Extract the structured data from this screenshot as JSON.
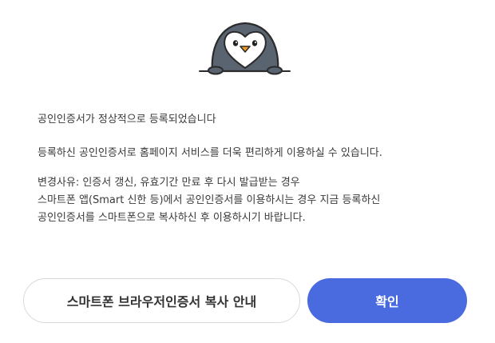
{
  "dialog": {
    "mascot_icon": "penguin-mascot-icon",
    "message_registered": "공인인증서가 정상적으로 등록되었습니다",
    "message_convenience": "등록하신 공인인증서로 홈페이지 서비스를 더욱 편리하게 이용하실 수 있습니다.",
    "reason_lines": [
      "변경사유: 인증서 갱신, 유효기간 만료 후 다시 발급받는 경우",
      "스마트폰 앱(Smart 신한 등)에서 공인인증서를 이용하시는 경우 지금 등록하신",
      "공인인증서를 스마트폰으로 복사하신 후 이용하시기 바랍니다."
    ]
  },
  "buttons": {
    "guide_label": "스마트폰 브라우저인증서 복사 안내",
    "confirm_label": "확인"
  },
  "colors": {
    "confirm_button": "#4a6ae0",
    "penguin_body": "#5a6470",
    "penguin_beak": "#f39a2b",
    "text": "#3a3a3a"
  }
}
